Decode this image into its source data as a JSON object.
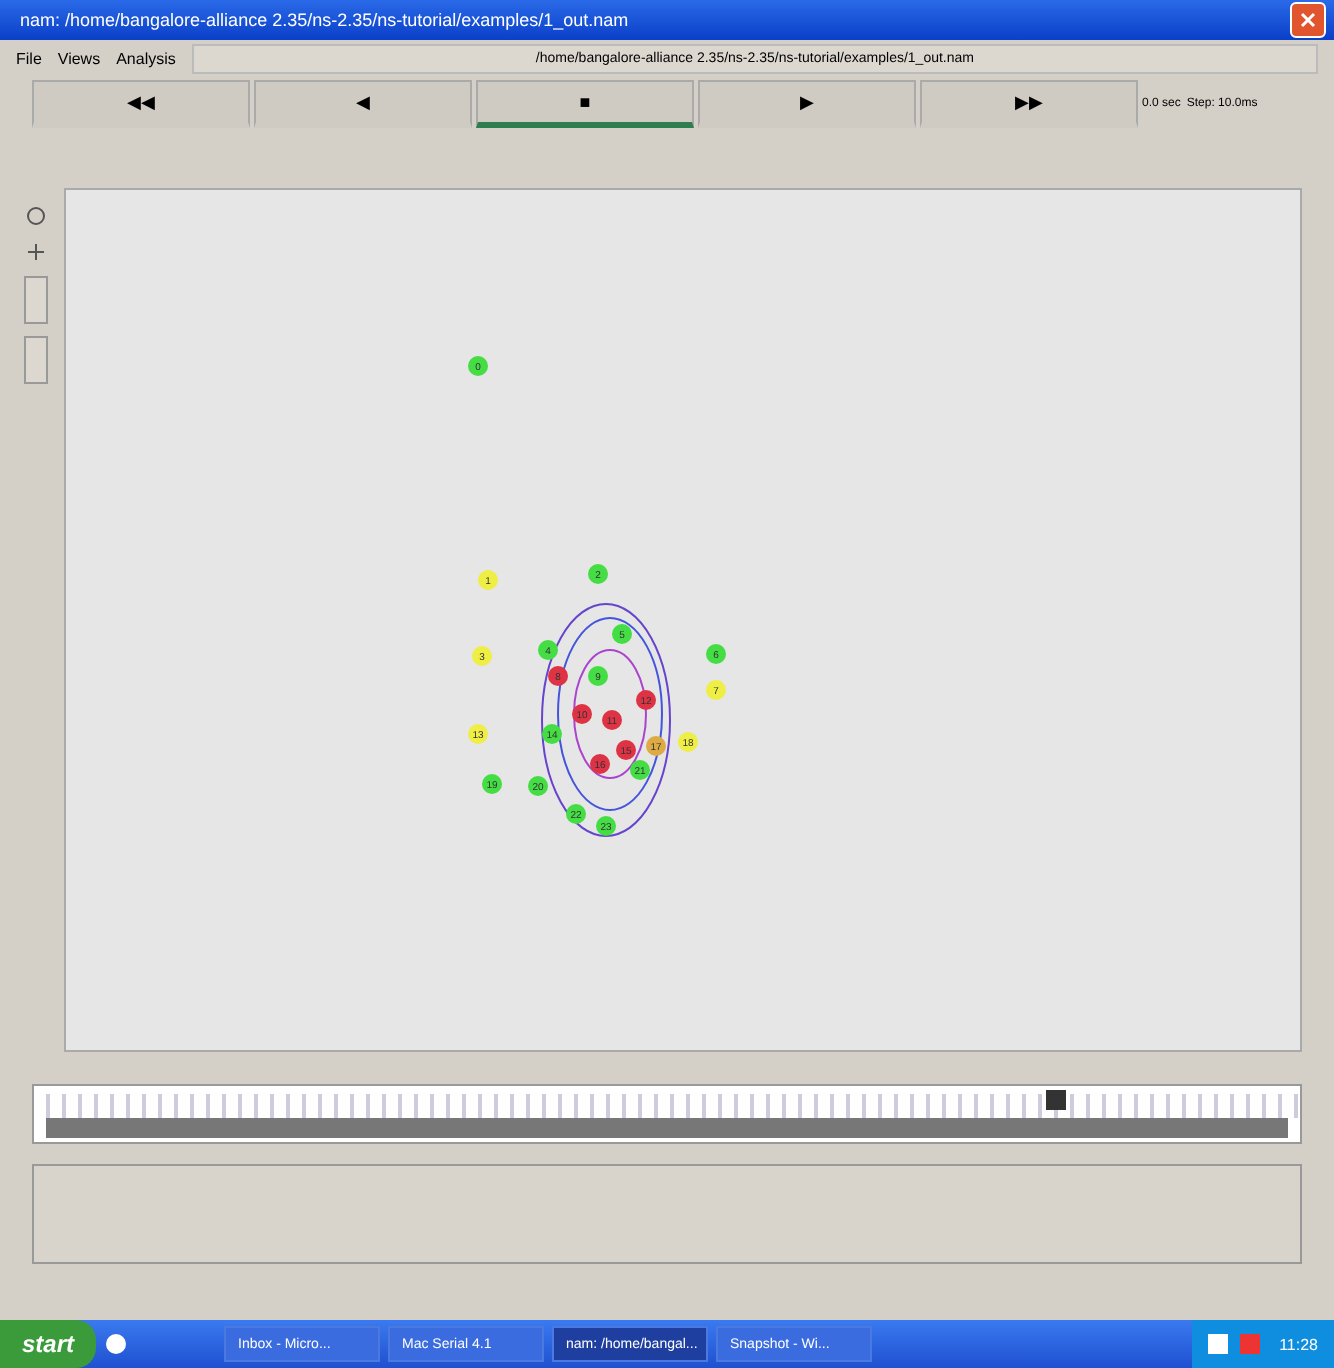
{
  "window": {
    "title": "nam: /home/bangalore-alliance 2.35/ns-2.35/ns-tutorial/examples/1_out.nam"
  },
  "menu": [
    "File",
    "Views",
    "Analysis"
  ],
  "file_label": "/home/bangalore-alliance 2.35/ns-2.35/ns-tutorial/examples/1_out.nam",
  "transport": [
    {
      "symbol": "◀◀",
      "selected": false
    },
    {
      "symbol": "◀",
      "selected": false
    },
    {
      "symbol": "■",
      "selected": true
    },
    {
      "symbol": "▶",
      "selected": false
    },
    {
      "symbol": "▶▶",
      "selected": false
    }
  ],
  "time": "0.0 sec",
  "step": "Step: 10.0ms",
  "nodes": [
    {
      "label": "0",
      "color": "#44dd44"
    },
    {
      "label": "1",
      "color": "#eeee44"
    },
    {
      "label": "2",
      "color": "#44dd44"
    },
    {
      "label": "3",
      "color": "#eeee44"
    },
    {
      "label": "4",
      "color": "#44dd44"
    },
    {
      "label": "5",
      "color": "#44dd44"
    },
    {
      "label": "6",
      "color": "#44dd44"
    },
    {
      "label": "7",
      "color": "#eeee44"
    },
    {
      "label": "8",
      "color": "#dd3344"
    },
    {
      "label": "9",
      "color": "#44dd44"
    },
    {
      "label": "10",
      "color": "#dd3344"
    },
    {
      "label": "11",
      "color": "#dd3344"
    },
    {
      "label": "12",
      "color": "#dd3344"
    },
    {
      "label": "13",
      "color": "#eeee44"
    },
    {
      "label": "14",
      "color": "#44dd44"
    },
    {
      "label": "15",
      "color": "#dd3344"
    },
    {
      "label": "16",
      "color": "#dd3344"
    },
    {
      "label": "17",
      "color": "#ddaa44"
    },
    {
      "label": "18",
      "color": "#eeee44"
    },
    {
      "label": "19",
      "color": "#44dd44"
    },
    {
      "label": "20",
      "color": "#44dd44"
    },
    {
      "label": "21",
      "color": "#44dd44"
    },
    {
      "label": "22",
      "color": "#44dd44"
    },
    {
      "label": "23",
      "color": "#44dd44"
    }
  ],
  "taskbar": {
    "start": "start",
    "tasks": [
      {
        "label": "Inbox - Micro...",
        "selected": false
      },
      {
        "label": "Mac Serial 4.1",
        "selected": false
      },
      {
        "label": "nam: /home/bangal...",
        "selected": true
      },
      {
        "label": "Snapshot - Wi...",
        "selected": false
      }
    ],
    "clock": "11:28"
  }
}
